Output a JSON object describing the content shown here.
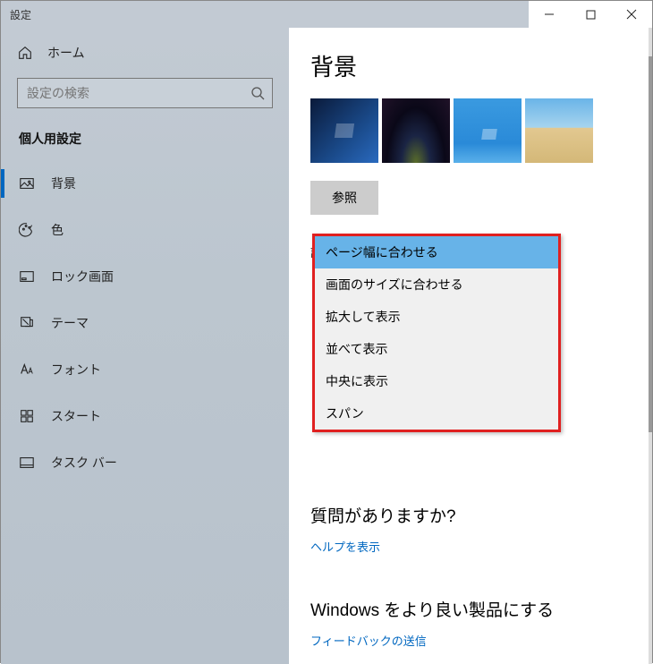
{
  "window": {
    "title": "設定"
  },
  "sidebar": {
    "home_label": "ホーム",
    "search_placeholder": "設定の検索",
    "category": "個人用設定",
    "items": [
      {
        "label": "背景"
      },
      {
        "label": "色"
      },
      {
        "label": "ロック画面"
      },
      {
        "label": "テーマ"
      },
      {
        "label": "フォント"
      },
      {
        "label": "スタート"
      },
      {
        "label": "タスク バー"
      }
    ]
  },
  "main": {
    "title": "背景",
    "browse_label": "参照",
    "fit_label": "調整方法を選ぶ",
    "fit_options": [
      "ページ幅に合わせる",
      "画面のサイズに合わせる",
      "拡大して表示",
      "並べて表示",
      "中央に表示",
      "スパン"
    ],
    "question_title": "質問がありますか?",
    "help_link": "ヘルプを表示",
    "improve_title": "Windows をより良い製品にする",
    "feedback_link": "フィードバックの送信"
  }
}
